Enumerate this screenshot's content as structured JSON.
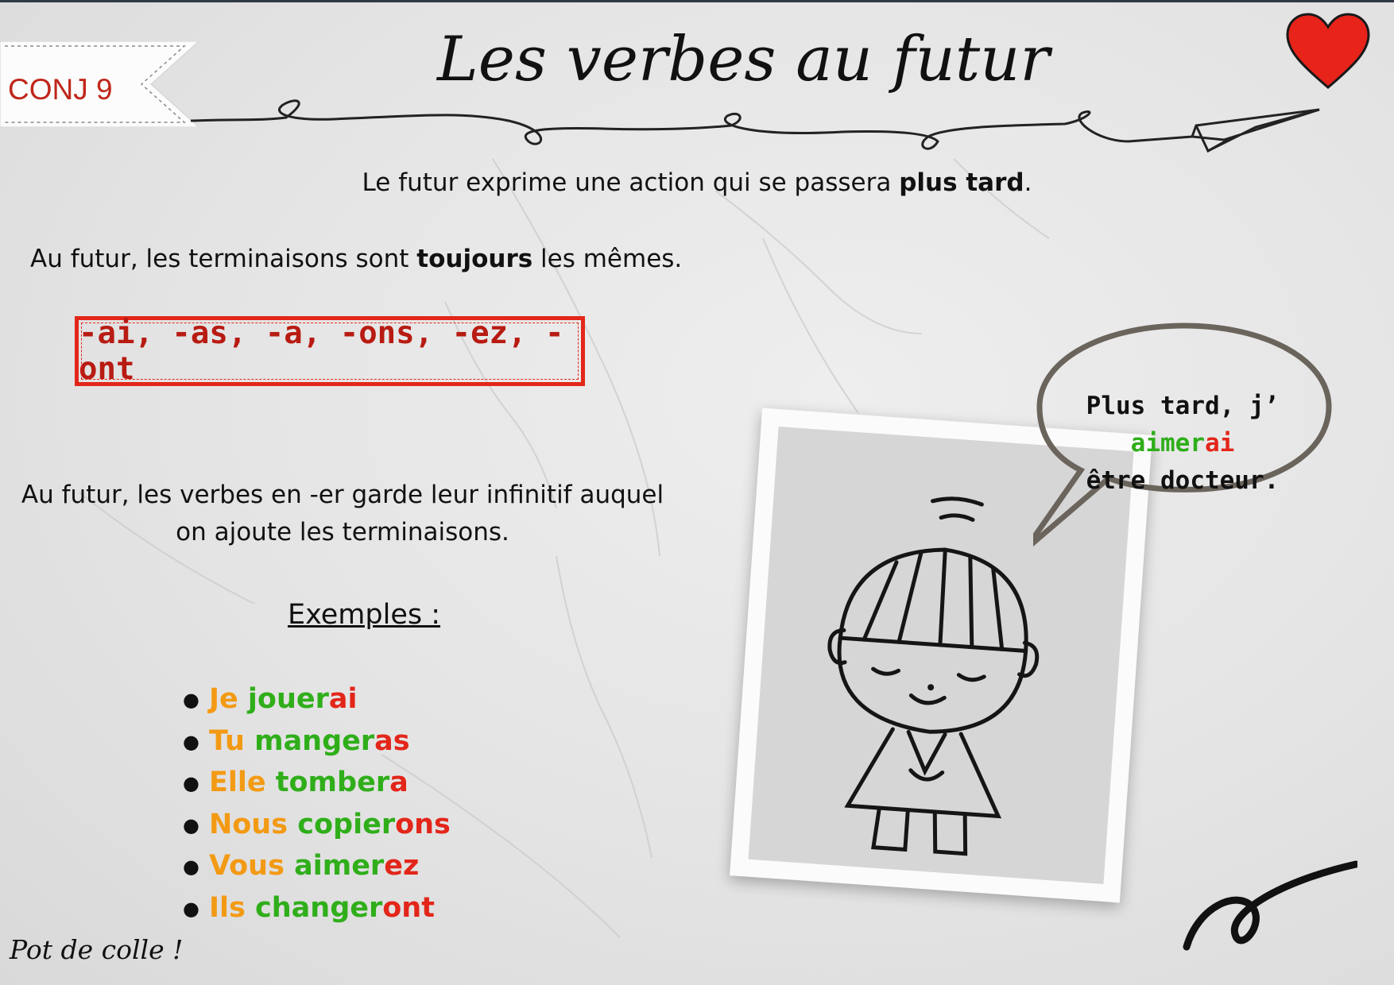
{
  "header": {
    "tag_label": "CONJ 9",
    "title": "Les verbes au futur"
  },
  "intro": {
    "text": "Le futur exprime une action qui se passera ",
    "bold": "plus tard",
    "end": "."
  },
  "rule1": {
    "before": "Au futur, les terminaisons sont ",
    "bold": "toujours",
    "after": " les mêmes."
  },
  "endings": "-ai, -as, -a, -ons, -ez, -ont",
  "rule2": {
    "line1": "Au futur, les verbes en -er garde leur infinitif auquel",
    "line2": "on ajoute les terminaisons."
  },
  "examples_title": "Exemples :",
  "examples": [
    {
      "pronoun": "Je",
      "stem": "jouer",
      "ending": "ai"
    },
    {
      "pronoun": "Tu",
      "stem": "manger",
      "ending": "as"
    },
    {
      "pronoun": "Elle",
      "stem": "tomber",
      "ending": "a"
    },
    {
      "pronoun": "Nous",
      "stem": "copier",
      "ending": "ons"
    },
    {
      "pronoun": "Vous",
      "stem": "aimer",
      "ending": "ez"
    },
    {
      "pronoun": "Ils",
      "stem": "changer",
      "ending": "ont"
    }
  ],
  "speech_bubble": {
    "before": "Plus tard, j’ ",
    "stem": "aimer",
    "ending": "ai",
    "line2": "être docteur."
  },
  "footer": "Pot de colle !",
  "colors": {
    "pronoun": "#f39a14",
    "stem": "#2fae1a",
    "ending": "#e3261a",
    "accent_red": "#e3261a"
  }
}
